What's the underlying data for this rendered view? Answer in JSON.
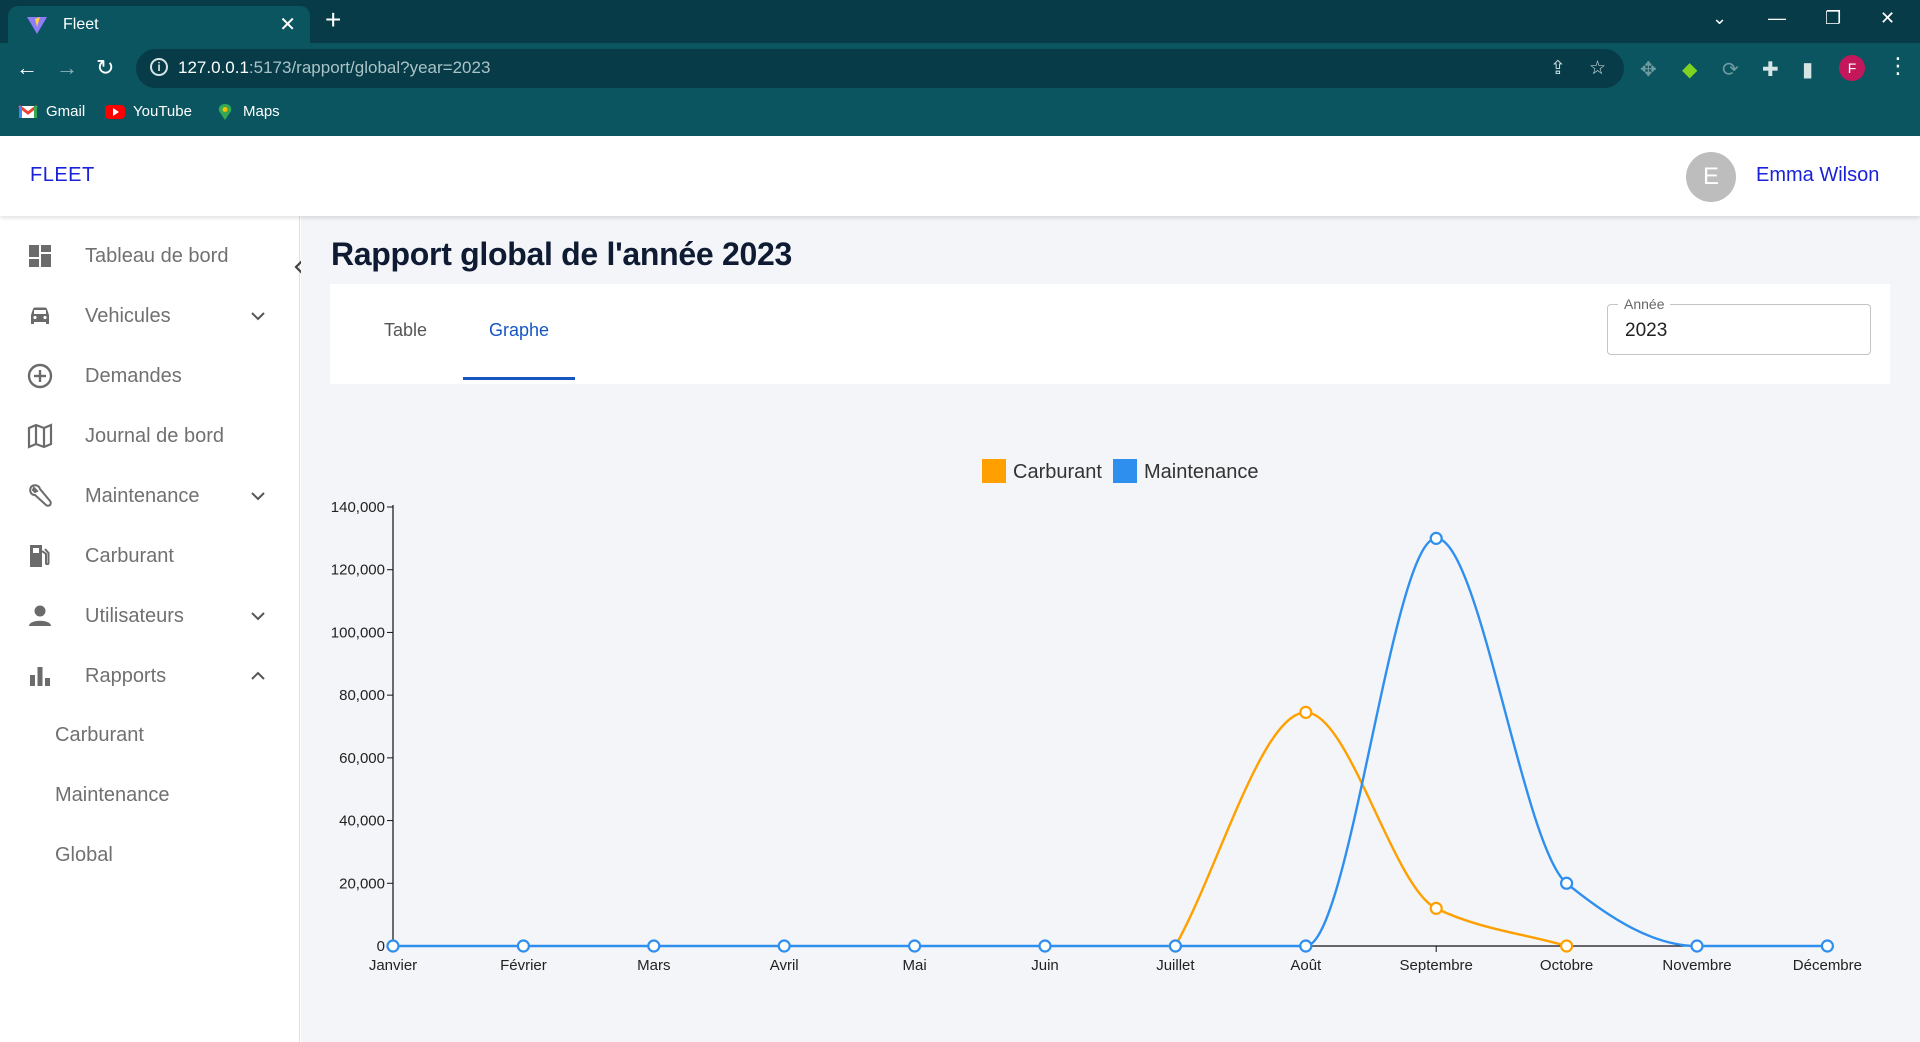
{
  "browser": {
    "tab_title": "Fleet",
    "url_host": "127.0.0.1",
    "url_rest": ":5173/rapport/global?year=2023",
    "profile_initial": "F",
    "bookmarks": [
      {
        "label": "Gmail",
        "icon": "gmail-icon"
      },
      {
        "label": "YouTube",
        "icon": "youtube-icon"
      },
      {
        "label": "Maps",
        "icon": "maps-icon"
      }
    ]
  },
  "header": {
    "brand": "FLEET",
    "user_initial": "E",
    "user_name": "Emma Wilson"
  },
  "sidebar": {
    "items": [
      {
        "label": "Tableau de bord",
        "icon": "dashboard-icon",
        "expandable": false
      },
      {
        "label": "Vehicules",
        "icon": "car-icon",
        "expandable": true,
        "expanded": false
      },
      {
        "label": "Demandes",
        "icon": "add-circle-icon",
        "expandable": false
      },
      {
        "label": "Journal de bord",
        "icon": "map-icon",
        "expandable": false
      },
      {
        "label": "Maintenance",
        "icon": "wrench-icon",
        "expandable": true,
        "expanded": false
      },
      {
        "label": "Carburant",
        "icon": "fuel-pump-icon",
        "expandable": false
      },
      {
        "label": "Utilisateurs",
        "icon": "person-icon",
        "expandable": true,
        "expanded": false
      },
      {
        "label": "Rapports",
        "icon": "bar-chart-icon",
        "expandable": true,
        "expanded": true
      }
    ],
    "sub_items": [
      "Carburant",
      "Maintenance",
      "Global"
    ]
  },
  "main": {
    "title": "Rapport global de l'année 2023",
    "tabs": [
      {
        "label": "Table",
        "active": false
      },
      {
        "label": "Graphe",
        "active": true
      }
    ],
    "year_field": {
      "label": "Année",
      "value": "2023"
    }
  },
  "colors": {
    "carburant": "#ffa000",
    "maintenance": "#2f8fef",
    "accent": "#1656c3",
    "chrome_dark": "#063b47",
    "chrome": "#0a5560"
  },
  "chart_data": {
    "type": "line",
    "categories": [
      "Janvier",
      "Février",
      "Mars",
      "Avril",
      "Mai",
      "Juin",
      "Juillet",
      "Août",
      "Septembre",
      "Octobre",
      "Novembre",
      "Décembre"
    ],
    "series": [
      {
        "name": "Carburant",
        "values": [
          null,
          null,
          null,
          null,
          null,
          null,
          0,
          74500,
          12000,
          0,
          null,
          null
        ]
      },
      {
        "name": "Maintenance",
        "values": [
          0,
          0,
          0,
          0,
          0,
          0,
          0,
          0,
          130000,
          20000,
          0,
          0
        ]
      }
    ],
    "yticks": [
      "0",
      "20,000",
      "40,000",
      "60,000",
      "80,000",
      "100,000",
      "120,000",
      "140,000"
    ],
    "ylim": [
      0,
      140000
    ],
    "legend": "top-center",
    "grid": false,
    "curve": "smooth"
  }
}
